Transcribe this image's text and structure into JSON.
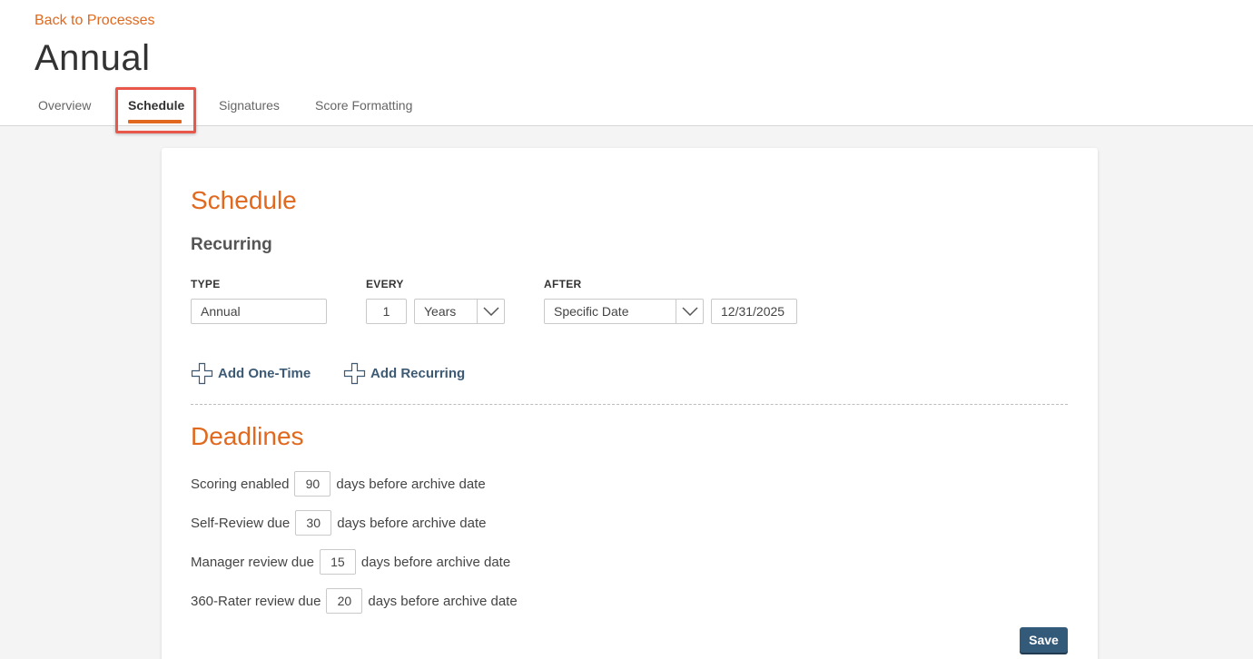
{
  "header": {
    "back_link": "Back to Processes",
    "title": "Annual",
    "tabs": [
      {
        "label": "Overview"
      },
      {
        "label": "Schedule"
      },
      {
        "label": "Signatures"
      },
      {
        "label": "Score Formatting"
      }
    ],
    "active_tab": "Schedule"
  },
  "schedule": {
    "title": "Schedule",
    "recurring_title": "Recurring",
    "type_label": "TYPE",
    "type_value": "Annual",
    "every_label": "EVERY",
    "every_value": "1",
    "every_unit": "Years",
    "after_label": "AFTER",
    "after_value": "Specific Date",
    "after_date": "12/31/2025",
    "add_one_time": "Add One-Time",
    "add_recurring": "Add Recurring"
  },
  "deadlines": {
    "title": "Deadlines",
    "suffix": "days before archive date",
    "rows": [
      {
        "label": "Scoring enabled",
        "value": "90"
      },
      {
        "label": "Self-Review due",
        "value": "30"
      },
      {
        "label": "Manager review due",
        "value": "15"
      },
      {
        "label": "360-Rater review due",
        "value": "20"
      }
    ]
  },
  "save_label": "Save",
  "colors": {
    "accent": "#e0691f",
    "link_blue": "#3d5a75",
    "save_bg": "#345a7a",
    "highlight": "#e8574a"
  }
}
